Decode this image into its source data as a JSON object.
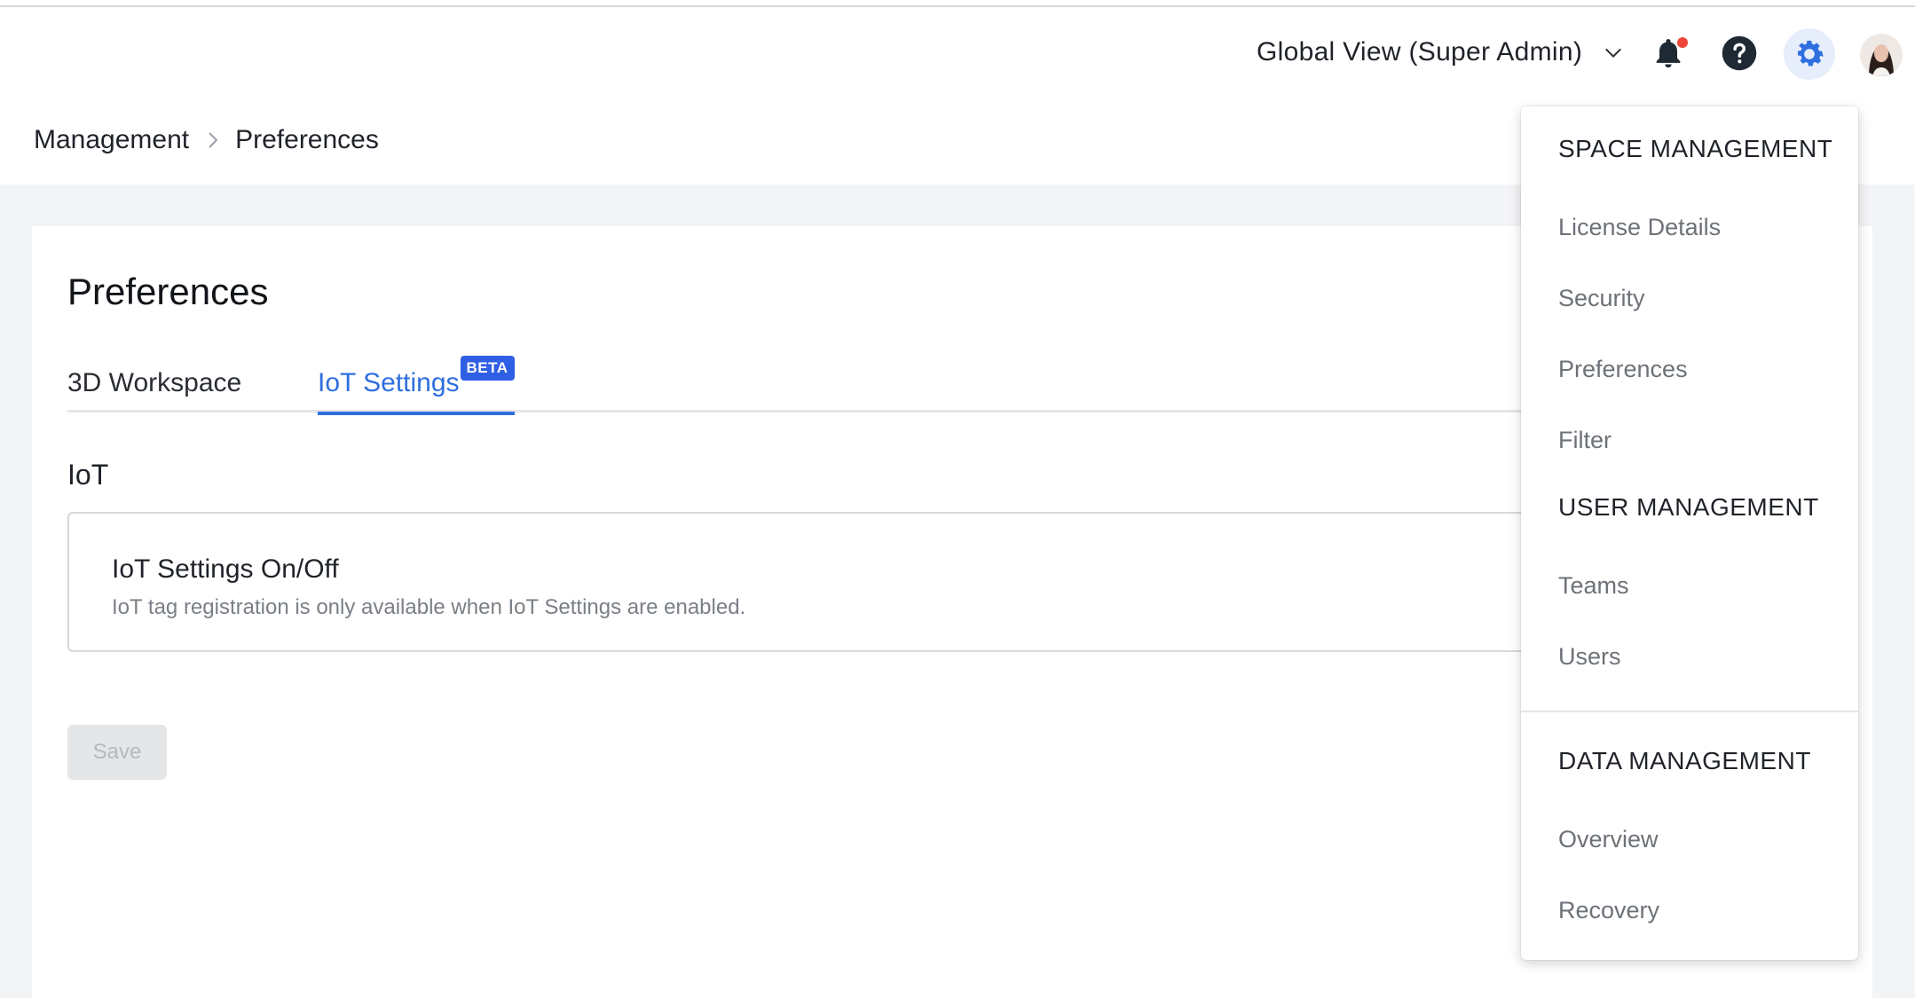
{
  "header": {
    "view_selector": "Global View (Super Admin)",
    "icons": [
      "bell-icon",
      "help-icon",
      "gear-icon",
      "avatar"
    ],
    "colors": {
      "accent": "#2f6fe0",
      "notification": "#f0453a"
    }
  },
  "breadcrumb": {
    "items": [
      "Management",
      "Preferences"
    ]
  },
  "page": {
    "title": "Preferences",
    "tabs": [
      {
        "label": "3D Workspace",
        "active": false
      },
      {
        "label": "IoT Settings",
        "active": true,
        "badge": "BETA"
      }
    ],
    "section_label": "IoT",
    "setting": {
      "title": "IoT Settings On/Off",
      "description": "IoT tag registration is only available when IoT Settings are enabled."
    },
    "save_label": "Save"
  },
  "settings_menu": {
    "groups": [
      {
        "heading": "SPACE MANAGEMENT",
        "items": [
          "License Details",
          "Security",
          "Preferences",
          "Filter"
        ]
      },
      {
        "heading": "USER MANAGEMENT",
        "items": [
          "Teams",
          "Users"
        ]
      },
      {
        "heading": "DATA MANAGEMENT",
        "items": [
          "Overview",
          "Recovery"
        ]
      }
    ]
  }
}
